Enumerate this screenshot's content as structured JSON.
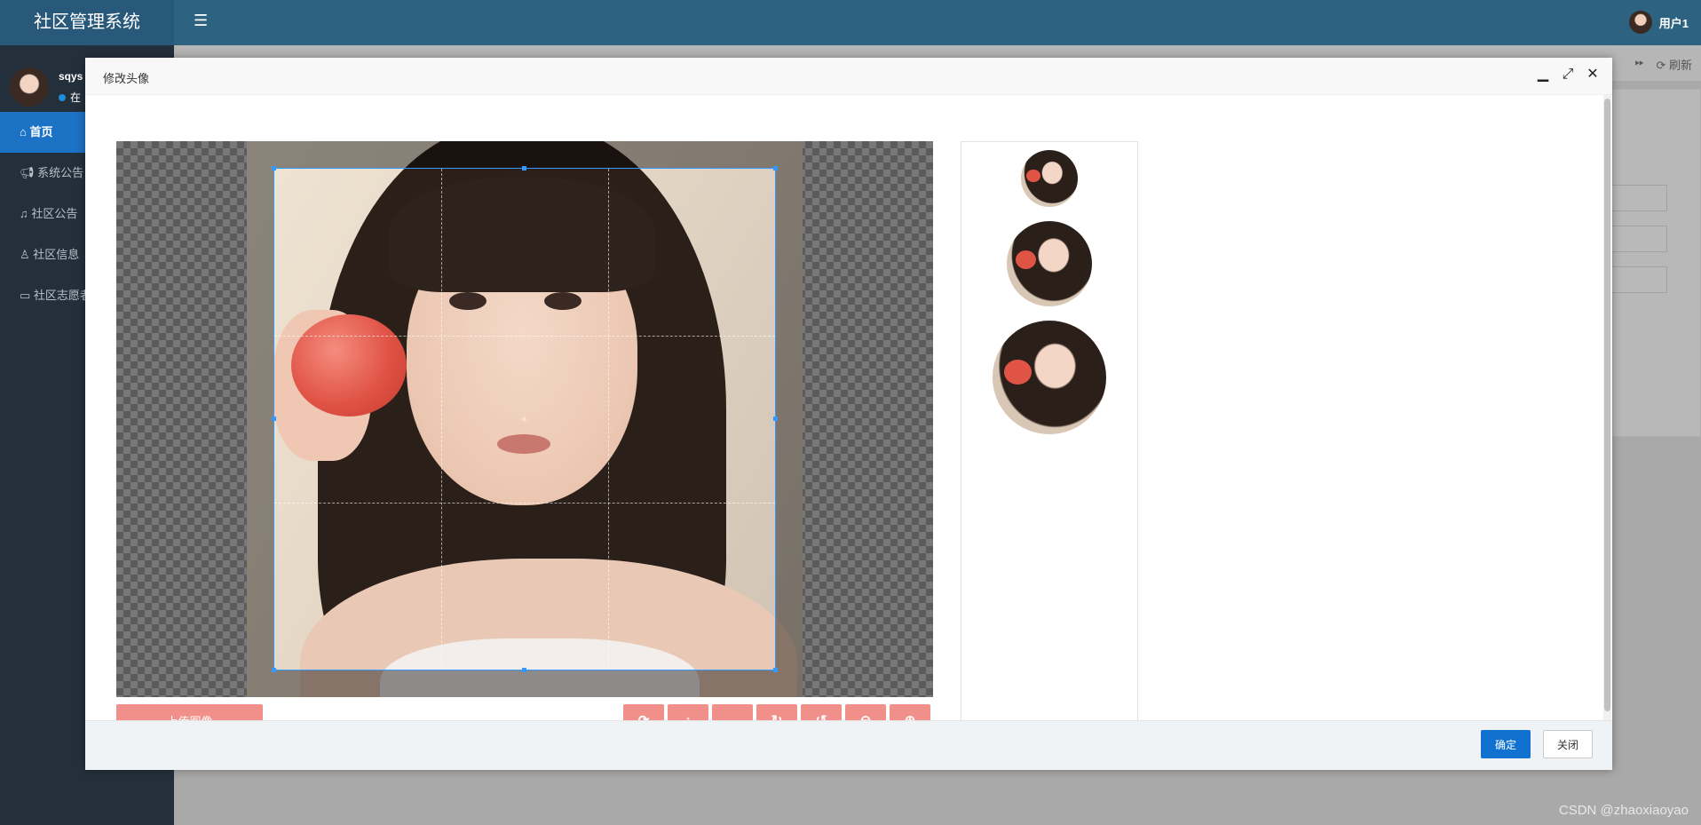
{
  "app": {
    "brand": "社区管理系统",
    "top_user": "用户1",
    "menu_icon": "hamburger-icon"
  },
  "sidebar": {
    "user_name": "sqys",
    "online_status": "在",
    "items": [
      {
        "label": "首页",
        "icon": "home-icon",
        "active": true
      },
      {
        "label": "系统公告",
        "icon": "megaphone-icon",
        "active": false
      },
      {
        "label": "社区公告",
        "icon": "bell-icon",
        "active": false
      },
      {
        "label": "社区信息",
        "icon": "walker-icon",
        "active": false
      },
      {
        "label": "社区志愿者",
        "icon": "comment-icon",
        "active": false
      }
    ]
  },
  "tabbar": {
    "refresh_label": "刷新"
  },
  "modal": {
    "title": "修改头像",
    "minimize_icon": "minimize-icon",
    "maximize_icon": "maximize-icon",
    "close_icon": "close-icon",
    "upload_label": "上传图像",
    "tools": [
      {
        "icon": "reset-icon",
        "glyph": "⟳"
      },
      {
        "icon": "flip-vertical-icon",
        "glyph": "↕"
      },
      {
        "icon": "flip-horizontal-icon",
        "glyph": "↔"
      },
      {
        "icon": "rotate-right-icon",
        "glyph": "↻"
      },
      {
        "icon": "rotate-left-icon",
        "glyph": "↺"
      },
      {
        "icon": "zoom-out-icon",
        "glyph": "⊖"
      },
      {
        "icon": "zoom-in-icon",
        "glyph": "⊕"
      }
    ],
    "confirm_label": "确定",
    "close_label": "关闭"
  },
  "colors": {
    "topbar": "#2e6281",
    "sidebar": "#23303c",
    "active_nav": "#1c72c4",
    "tool_button": "#f1908a",
    "primary_button": "#1171d1",
    "crop_outline": "#3399ff"
  },
  "watermark": "CSDN @zhaoxiaoyao"
}
